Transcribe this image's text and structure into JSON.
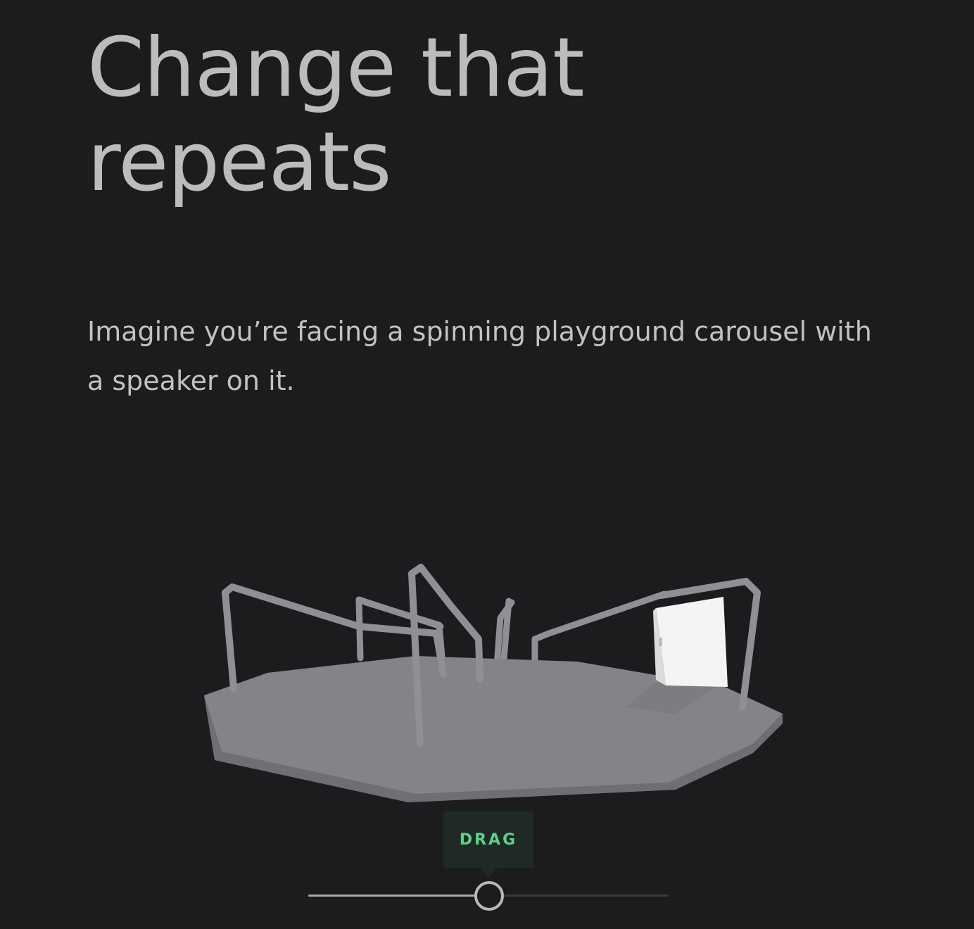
{
  "heading": {
    "line1": "Change that",
    "line2": "repeats"
  },
  "intro": {
    "text": "Imagine you’re facing a spinning playground carousel with a speaker on it."
  },
  "colors": {
    "background": "#1c1c1e",
    "platform_top": "#838389",
    "platform_side": "#77777b",
    "rails": "#8f8f95",
    "speaker": "#f2f2f2",
    "drag_accent": "#5fd08c"
  },
  "drag_hint": {
    "label": "DRAG"
  },
  "slider": {
    "value": 0.5
  }
}
